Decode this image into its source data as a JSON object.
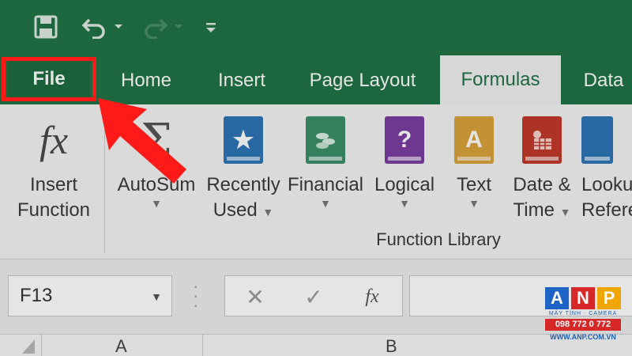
{
  "quick_access": {
    "save_icon": "save-icon",
    "undo_icon": "undo-icon",
    "redo_icon": "redo-icon",
    "customize_icon": "customize-quick-access-icon"
  },
  "tabs": {
    "file": "File",
    "home": "Home",
    "insert": "Insert",
    "page_layout": "Page Layout",
    "formulas": "Formulas",
    "data": "Data"
  },
  "ribbon": {
    "insert_function": {
      "line1": "Insert",
      "line2": "Function",
      "icon_text": "fx"
    },
    "autosum": {
      "line1": "AutoSum",
      "icon_text": "Σ"
    },
    "recently_used": {
      "line1": "Recently",
      "line2": "Used"
    },
    "financial": {
      "line1": "Financial"
    },
    "logical": {
      "line1": "Logical",
      "icon_text": "?"
    },
    "text": {
      "line1": "Text",
      "icon_text": "A"
    },
    "date_time": {
      "line1": "Date &",
      "line2": "Time"
    },
    "lookup": {
      "line1": "Looku",
      "line2": "Refere"
    },
    "group_label": "Function Library"
  },
  "formula_bar": {
    "name_box": "F13",
    "cancel_symbol": "✕",
    "enter_symbol": "✓",
    "fx_symbol": "fx",
    "value": ""
  },
  "columns": [
    "A",
    "B"
  ],
  "watermark": {
    "letters": [
      "A",
      "N",
      "P"
    ],
    "subtitle": "MÁY TÍNH · CAMERA",
    "phone": "098 772 0 772",
    "website": "WWW.ANP.COM.VN"
  },
  "colors": {
    "excel_green": "#217346",
    "highlight_red": "#ff1a1a",
    "book_blue": "#2e75b6",
    "book_green": "#3a8f6a",
    "book_purple": "#7b3fa1",
    "book_yellow": "#d8a33a",
    "book_red": "#c0392b"
  }
}
